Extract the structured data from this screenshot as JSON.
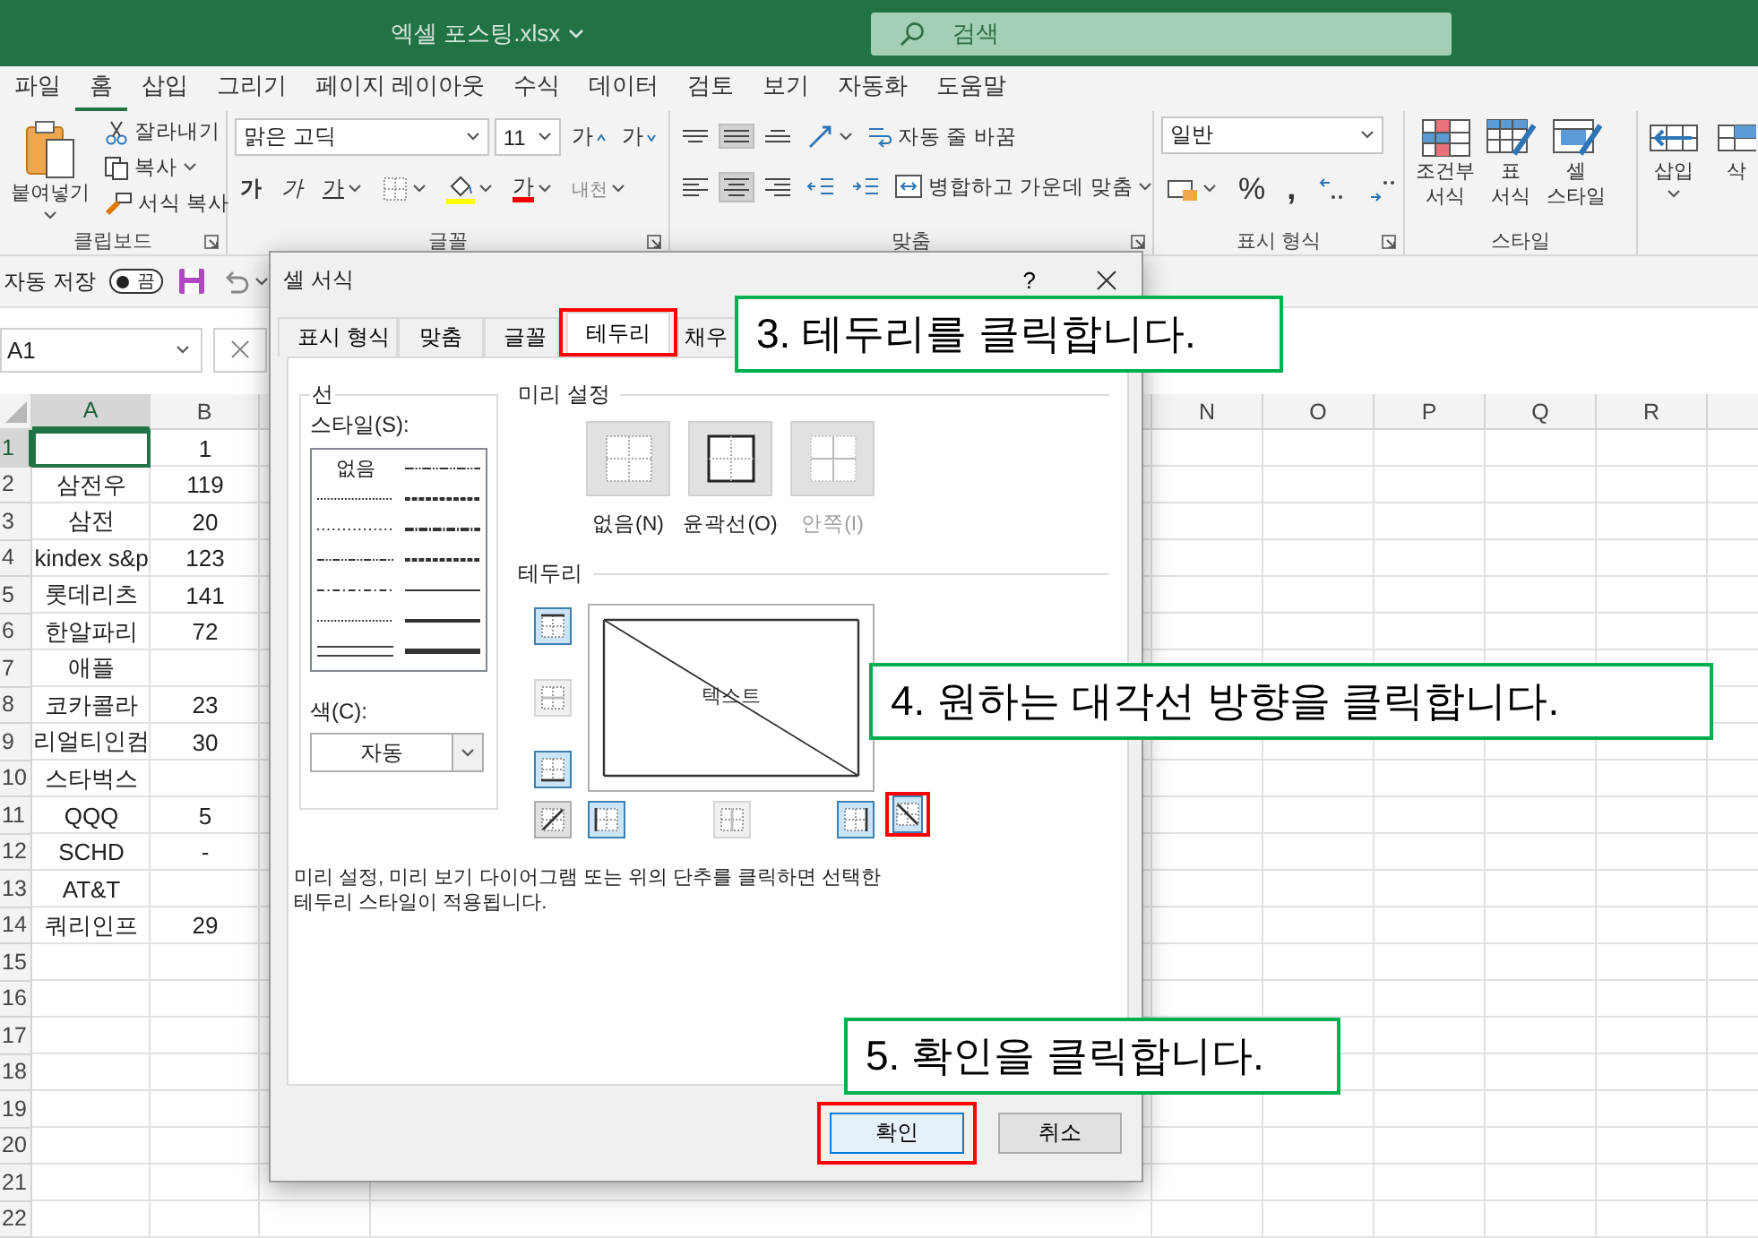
{
  "window": {
    "title": "엑셀 포스팅.xlsx",
    "search_placeholder": "검색"
  },
  "menu_tabs": [
    {
      "label": "파일",
      "selected": false
    },
    {
      "label": "홈",
      "selected": true
    },
    {
      "label": "삽입",
      "selected": false
    },
    {
      "label": "그리기",
      "selected": false
    },
    {
      "label": "페이지 레이아웃",
      "selected": false
    },
    {
      "label": "수식",
      "selected": false
    },
    {
      "label": "데이터",
      "selected": false
    },
    {
      "label": "검토",
      "selected": false
    },
    {
      "label": "보기",
      "selected": false
    },
    {
      "label": "자동화",
      "selected": false
    },
    {
      "label": "도움말",
      "selected": false
    }
  ],
  "ribbon": {
    "clipboard": {
      "paste": "붙여넣기",
      "cut": "잘라내기",
      "copy": "복사",
      "format_painter": "서식 복사",
      "label": "클립보드"
    },
    "font": {
      "name": "맑은 고딕",
      "size": "11",
      "grow": "가",
      "shrink": "가",
      "bold": "가",
      "italic": "가",
      "underline": "가",
      "font_color": "가",
      "phonetic": "내천",
      "label": "글꼴"
    },
    "alignment": {
      "vertical": [
        {
          "kind": "top",
          "selected": false
        },
        {
          "kind": "middle",
          "selected": true
        },
        {
          "kind": "bottom",
          "selected": false
        }
      ],
      "horizontal": [
        {
          "kind": "left",
          "selected": false
        },
        {
          "kind": "center",
          "selected": true
        },
        {
          "kind": "right",
          "selected": false
        }
      ],
      "wrap": "자동 줄 바꿈",
      "merge": "병합하고 가운데 맞춤",
      "label": "맞춤"
    },
    "number": {
      "format": "일반",
      "percent": "%",
      "comma": ",",
      "label": "표시 형식"
    },
    "styles": {
      "buttons": [
        {
          "kind": "conditional",
          "lines": [
            "조건부",
            "서식"
          ]
        },
        {
          "kind": "table",
          "lines": [
            "표",
            "서식"
          ]
        },
        {
          "kind": "cell",
          "lines": [
            "셀",
            "스타일"
          ]
        }
      ],
      "label": "스타일"
    },
    "cells": {
      "insert": "삽입",
      "delete": "삭"
    }
  },
  "quick_access": {
    "autosave_label": "자동 저장",
    "autosave_on": false,
    "toggle_text": "끔"
  },
  "formula_bar": {
    "name_box": "A1"
  },
  "sheet": {
    "left_columns": [
      {
        "label": "A",
        "selected": true
      },
      {
        "label": "B",
        "selected": false
      }
    ],
    "right_columns": [
      {
        "label": "N"
      },
      {
        "label": "O"
      },
      {
        "label": "P"
      },
      {
        "label": "Q"
      },
      {
        "label": "R"
      }
    ],
    "rows": [
      {
        "header": "1",
        "selected": true,
        "b": "1"
      },
      {
        "header": "2",
        "selected": false,
        "a": "삼전우",
        "b": "119"
      },
      {
        "header": "3",
        "selected": false,
        "a": "삼전",
        "b": "20"
      },
      {
        "header": "4",
        "selected": false,
        "a": "kindex s&p",
        "b": "123"
      },
      {
        "header": "5",
        "selected": false,
        "a": "롯데리츠",
        "b": "141"
      },
      {
        "header": "6",
        "selected": false,
        "a": "한알파리",
        "b": "72"
      },
      {
        "header": "7",
        "selected": false,
        "a": "애플"
      },
      {
        "header": "8",
        "selected": false,
        "a": "코카콜라",
        "b": "23"
      },
      {
        "header": "9",
        "selected": false,
        "a": "리얼티인컴",
        "b": "30"
      },
      {
        "header": "10",
        "selected": false,
        "a": "스타벅스"
      },
      {
        "header": "11",
        "selected": false,
        "a": "QQQ",
        "b": "5"
      },
      {
        "header": "12",
        "selected": false,
        "a": "SCHD",
        "b": "-"
      },
      {
        "header": "13",
        "selected": false,
        "a": "AT&T"
      },
      {
        "header": "14",
        "selected": false,
        "a": "쿼리인프",
        "b": "29"
      },
      {
        "header": "15",
        "selected": false
      },
      {
        "header": "16",
        "selected": false
      },
      {
        "header": "17",
        "selected": false
      },
      {
        "header": "18",
        "selected": false
      },
      {
        "header": "19",
        "selected": false
      },
      {
        "header": "20",
        "selected": false
      },
      {
        "header": "21",
        "selected": false
      },
      {
        "header": "22",
        "selected": false
      }
    ]
  },
  "dialog": {
    "title": "셀 서식",
    "help": "?",
    "tabs": [
      {
        "label": "표시 형식",
        "selected": false,
        "highlighted": false
      },
      {
        "label": "맞춤",
        "selected": false,
        "highlighted": false
      },
      {
        "label": "글꼴",
        "selected": false,
        "highlighted": false
      },
      {
        "label": "테두리",
        "selected": true,
        "highlighted": true
      },
      {
        "label": "채우",
        "selected": false,
        "highlighted": false
      }
    ],
    "line_group": {
      "title": "선",
      "style_label": "스타일(S):",
      "none_option": "없음",
      "color_label": "색(C):",
      "color_value": "자동"
    },
    "presets_title": "미리 설정",
    "presets": [
      {
        "kind": "none",
        "label": "없음(N)",
        "disabled": false
      },
      {
        "kind": "outline",
        "label": "윤곽선(O)",
        "disabled": false
      },
      {
        "kind": "inside",
        "label": "안쪽(I)",
        "disabled": true
      }
    ],
    "border_title": "테두리",
    "preview_text": "텍스트",
    "border_buttons": [
      {
        "kind": "top",
        "selected": true,
        "disabled": false,
        "highlighted": false
      },
      {
        "kind": "middle-h",
        "selected": false,
        "disabled": true,
        "highlighted": false
      },
      {
        "kind": "bottom",
        "selected": true,
        "disabled": false,
        "highlighted": false
      },
      {
        "kind": "diagonal-up",
        "selected": false,
        "disabled": false,
        "highlighted": false
      },
      {
        "kind": "left",
        "selected": true,
        "disabled": false,
        "highlighted": false
      },
      {
        "kind": "middle-v",
        "selected": false,
        "disabled": true,
        "highlighted": false
      },
      {
        "kind": "right",
        "selected": true,
        "disabled": false,
        "highlighted": false
      },
      {
        "kind": "diagonal-down",
        "selected": true,
        "disabled": false,
        "highlighted": true
      }
    ],
    "hint": "미리 설정, 미리 보기 다이어그램 또는 위의 단추를 클릭하면 선택한 테두리 스타일이 적용됩니다.",
    "buttons": [
      {
        "label": "확인",
        "default": true,
        "highlighted": true
      },
      {
        "label": "취소",
        "default": false,
        "highlighted": false
      }
    ]
  },
  "callouts": [
    {
      "text": "3. 테두리를 클릭합니다."
    },
    {
      "text": "4. 원하는 대각선 방향을 클릭합니다."
    },
    {
      "text": "5. 확인을 클릭합니다."
    }
  ]
}
